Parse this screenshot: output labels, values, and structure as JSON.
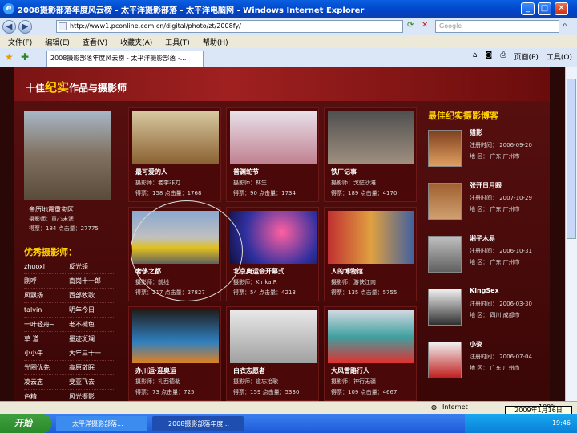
{
  "window": {
    "title": "2008摄影部落年度风云榜 - 太平洋摄影部落 - 太平洋电脑网 - Windows Internet Explorer"
  },
  "address": {
    "url": "http://www1.pconline.com.cn/digital/photo/zt/2008fy/",
    "search_placeholder": "Google"
  },
  "menu": [
    "文件(F)",
    "编辑(E)",
    "查看(V)",
    "收藏夹(A)",
    "工具(T)",
    "帮助(H)"
  ],
  "tab": {
    "label": "2008摄影部落年度风云榜 - 太平洋摄影部落 -..."
  },
  "toolbar": {
    "page": "页面(P)",
    "tools": "工具(O)"
  },
  "banner": {
    "prefix": "十佳",
    "highlight": "纪实",
    "suffix": "作品与摄影师"
  },
  "left_feature": {
    "title": "亲历地震重灾区",
    "author": "摄影师：童心未泯",
    "stats": "得票：184 点击量：27775"
  },
  "photographers_title": "优秀摄影师：",
  "photographers": [
    [
      "zhuoxl",
      "反光镜"
    ],
    [
      "刚呼",
      "南岗十一郎"
    ],
    [
      "风飘扬",
      "西部牧歌"
    ],
    [
      "talvin",
      "明年今日"
    ],
    [
      "一叶轻舟~",
      "老不褪色"
    ],
    [
      "草 道",
      "墨迹斑斓"
    ],
    [
      "小小牛",
      "大年三十一"
    ],
    [
      "光圈优先",
      "高原散眠"
    ],
    [
      "凌云志",
      "斐亚飞去"
    ],
    [
      "色精",
      "风光摄影"
    ]
  ],
  "cards": [
    {
      "title": "最可爱的人",
      "author": "摄影师：老李非刀",
      "stats": "得票：158 点击量：1768"
    },
    {
      "title": "普渊蛇节",
      "author": "摄影师：林生",
      "stats": "得票：90 点击量：1734"
    },
    {
      "title": "铁厂记事",
      "author": "摄影师：戈壁沙滩",
      "stats": "得票：189 点击量：4170"
    },
    {
      "title": "奢侈之都",
      "author": "摄影师：前线",
      "stats": "得票：217 点击量：27827"
    },
    {
      "title": "北京奥运会开幕式",
      "author": "摄影师：Kirika.R",
      "stats": "得票：54 点击量：4213"
    },
    {
      "title": "人的博物馆",
      "author": "摄影师：游侠江南",
      "stats": "得票：135 点击量：5755"
    },
    {
      "title": "办川运·迎奥运",
      "author": "摄影师：扎西德勒",
      "stats": "得票：73 点击量：725"
    },
    {
      "title": "白衣志愿者",
      "author": "摄影师：道忘抬歌",
      "stats": "得票：159 点击量：5330"
    },
    {
      "title": "大风雪路行人",
      "author": "摄影师：神行无疆",
      "stats": "得票：109 点击量：4667"
    }
  ],
  "blog_title": "最佳纪实摄影博客",
  "blogs": [
    {
      "name": "猎影",
      "date": "注册时间：    2006-09-20",
      "region": "地  区：  广东  广州市"
    },
    {
      "name": "张开日月眼",
      "date": "注册时间：    2007-10-29",
      "region": "地  区：  广东  广州市"
    },
    {
      "name": "湘子木易",
      "date": "注册时间：    2006-10-31",
      "region": "地  区：  广东  广州市"
    },
    {
      "name": "KingSex",
      "date": "注册时间：    2006-03-30",
      "region": "地  区：  四川  成都市"
    },
    {
      "name": "小瓷",
      "date": "注册时间：    2006-07-04",
      "region": "地  区：  广东  广州市"
    }
  ],
  "status": {
    "zone": "Internet",
    "zoom": "100%"
  },
  "taskbar": {
    "start": "开始",
    "tasks": [
      "太平洋摄影部落...",
      "2008摄影部落年度..."
    ],
    "time": "19:46",
    "date": "2009年1月16日"
  }
}
